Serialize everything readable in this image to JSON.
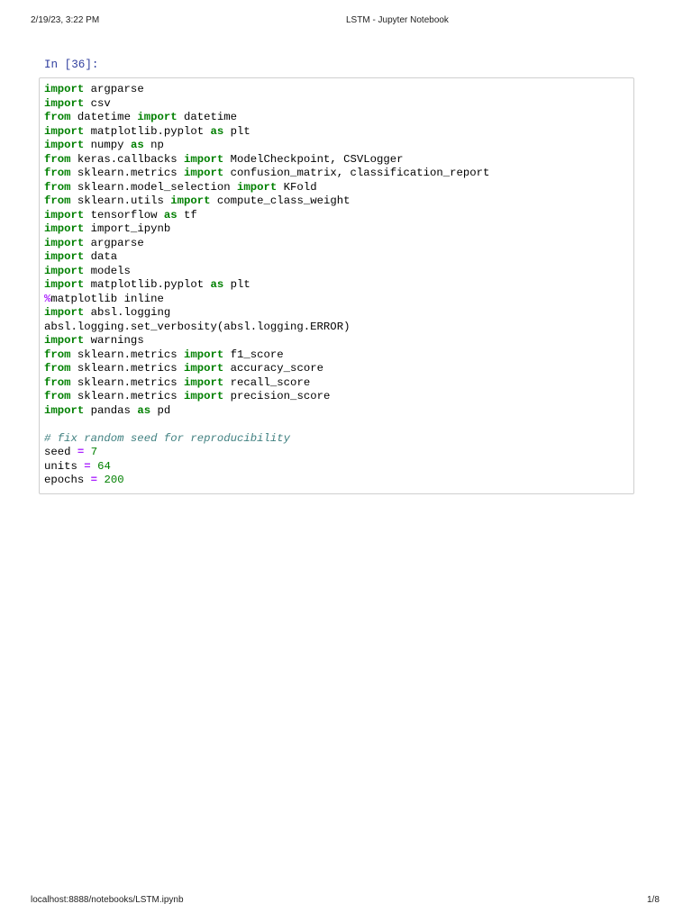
{
  "header": {
    "datetime": "2/19/23, 3:22 PM",
    "title": "LSTM - Jupyter Notebook"
  },
  "footer": {
    "url": "localhost:8888/notebooks/LSTM.ipynb",
    "page": "1/8"
  },
  "cell": {
    "prompt": "In [36]:",
    "lines": [
      [
        [
          "k",
          "import"
        ],
        [
          "t",
          " argparse"
        ]
      ],
      [
        [
          "k",
          "import"
        ],
        [
          "t",
          " csv"
        ]
      ],
      [
        [
          "k",
          "from"
        ],
        [
          "t",
          " datetime "
        ],
        [
          "k",
          "import"
        ],
        [
          "t",
          " datetime"
        ]
      ],
      [
        [
          "k",
          "import"
        ],
        [
          "t",
          " matplotlib.pyplot "
        ],
        [
          "k",
          "as"
        ],
        [
          "t",
          " plt"
        ]
      ],
      [
        [
          "k",
          "import"
        ],
        [
          "t",
          " numpy "
        ],
        [
          "k",
          "as"
        ],
        [
          "t",
          " np"
        ]
      ],
      [
        [
          "k",
          "from"
        ],
        [
          "t",
          " keras.callbacks "
        ],
        [
          "k",
          "import"
        ],
        [
          "t",
          " ModelCheckpoint, CSVLogger"
        ]
      ],
      [
        [
          "k",
          "from"
        ],
        [
          "t",
          " sklearn.metrics "
        ],
        [
          "k",
          "import"
        ],
        [
          "t",
          " confusion_matrix, classification_report"
        ]
      ],
      [
        [
          "k",
          "from"
        ],
        [
          "t",
          " sklearn.model_selection "
        ],
        [
          "k",
          "import"
        ],
        [
          "t",
          " KFold"
        ]
      ],
      [
        [
          "k",
          "from"
        ],
        [
          "t",
          " sklearn.utils "
        ],
        [
          "k",
          "import"
        ],
        [
          "t",
          " compute_class_weight"
        ]
      ],
      [
        [
          "k",
          "import"
        ],
        [
          "t",
          " tensorflow "
        ],
        [
          "k",
          "as"
        ],
        [
          "t",
          " tf"
        ]
      ],
      [
        [
          "k",
          "import"
        ],
        [
          "t",
          " import_ipynb"
        ]
      ],
      [
        [
          "k",
          "import"
        ],
        [
          "t",
          " argparse"
        ]
      ],
      [
        [
          "k",
          "import"
        ],
        [
          "t",
          " data"
        ]
      ],
      [
        [
          "k",
          "import"
        ],
        [
          "t",
          " models"
        ]
      ],
      [
        [
          "k",
          "import"
        ],
        [
          "t",
          " matplotlib.pyplot "
        ],
        [
          "k",
          "as"
        ],
        [
          "t",
          " plt"
        ]
      ],
      [
        [
          "m",
          "%"
        ],
        [
          "t",
          "matplotlib inline"
        ]
      ],
      [
        [
          "k",
          "import"
        ],
        [
          "t",
          " absl.logging"
        ]
      ],
      [
        [
          "t",
          "absl.logging.set_verbosity(absl.logging.ERROR)"
        ]
      ],
      [
        [
          "k",
          "import"
        ],
        [
          "t",
          " warnings"
        ]
      ],
      [
        [
          "k",
          "from"
        ],
        [
          "t",
          " sklearn.metrics "
        ],
        [
          "k",
          "import"
        ],
        [
          "t",
          " f1_score"
        ]
      ],
      [
        [
          "k",
          "from"
        ],
        [
          "t",
          " sklearn.metrics "
        ],
        [
          "k",
          "import"
        ],
        [
          "t",
          " accuracy_score"
        ]
      ],
      [
        [
          "k",
          "from"
        ],
        [
          "t",
          " sklearn.metrics "
        ],
        [
          "k",
          "import"
        ],
        [
          "t",
          " recall_score"
        ]
      ],
      [
        [
          "k",
          "from"
        ],
        [
          "t",
          " sklearn.metrics "
        ],
        [
          "k",
          "import"
        ],
        [
          "t",
          " precision_score"
        ]
      ],
      [
        [
          "k",
          "import"
        ],
        [
          "t",
          " pandas "
        ],
        [
          "k",
          "as"
        ],
        [
          "t",
          " pd"
        ]
      ],
      [],
      [
        [
          "c",
          "# fix random seed for reproducibility"
        ]
      ],
      [
        [
          "t",
          "seed "
        ],
        [
          "o",
          "="
        ],
        [
          "t",
          " "
        ],
        [
          "n",
          "7"
        ]
      ],
      [
        [
          "t",
          "units "
        ],
        [
          "o",
          "="
        ],
        [
          "t",
          " "
        ],
        [
          "n",
          "64"
        ]
      ],
      [
        [
          "t",
          "epochs "
        ],
        [
          "o",
          "="
        ],
        [
          "t",
          " "
        ],
        [
          "n",
          "200"
        ]
      ]
    ]
  }
}
